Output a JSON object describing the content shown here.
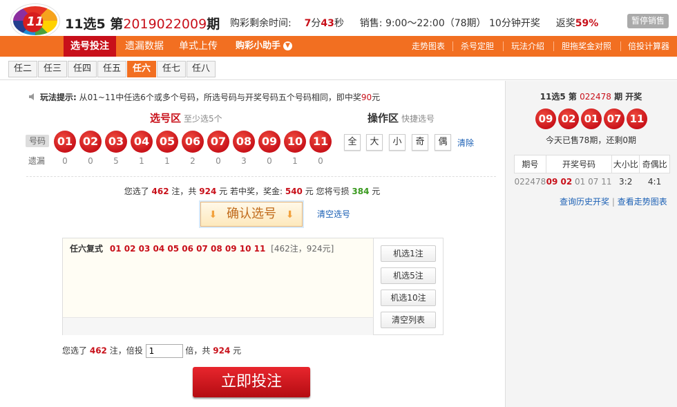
{
  "header": {
    "logo_text": "11",
    "lottery_name": "11选5",
    "issue_prefix": "第",
    "issue_number": "2019022009",
    "issue_suffix": "期",
    "countdown_label": "购彩剩余时间:",
    "countdown_min": "7",
    "min_unit": "分",
    "countdown_sec": "43",
    "sec_unit": "秒",
    "sales_label": "销售:",
    "sales_time": "9:00～22:00（78期）",
    "draw_freq": "10分钟开奖",
    "rebate_label": "返奖",
    "rebate_value": "59%",
    "stop_sales": "暂停销售"
  },
  "nav": {
    "items": [
      "选号投注",
      "遗漏数据",
      "单式上传",
      "购彩小助手"
    ],
    "right_links": [
      "走势图表",
      "杀号定胆",
      "玩法介绍",
      "胆拖奖金对照",
      "倍投计算器"
    ]
  },
  "subtabs": [
    "任二",
    "任三",
    "任四",
    "任五",
    "任六",
    "任七",
    "任八"
  ],
  "tip": {
    "label": "玩法提示:",
    "text": "从01~11中任选6个或多个号码，所选号码与开奖号码五个号码相同，即中奖",
    "prize": "90",
    "unit": "元"
  },
  "select_zone": {
    "title": "选号区",
    "subtitle": "至少选5个",
    "number_label": "号码",
    "miss_label": "遗漏",
    "numbers": [
      "01",
      "02",
      "03",
      "04",
      "05",
      "06",
      "07",
      "08",
      "09",
      "10",
      "11"
    ],
    "misses": [
      "0",
      "0",
      "5",
      "1",
      "1",
      "2",
      "0",
      "3",
      "0",
      "1",
      "0"
    ]
  },
  "op_zone": {
    "title": "操作区",
    "subtitle": "快捷选号",
    "buttons": [
      "全",
      "大",
      "小",
      "奇",
      "偶"
    ],
    "clear": "清除"
  },
  "summary": {
    "p1": "您选了",
    "bets": "462",
    "p2": "注，共",
    "amount": "924",
    "p3": "元 若中奖，奖金:",
    "prize": "540",
    "p4": "元 您将亏损",
    "loss": "384",
    "p5": "元"
  },
  "confirm": {
    "label": "确认选号",
    "clear_label": "清空选号"
  },
  "bet_list": {
    "type": "任六复式",
    "numbers": "01 02 03 04 05 06 07 08 09 10 11",
    "detail": "[462注，924元]",
    "buttons": [
      "机选1注",
      "机选5注",
      "机选10注",
      "清空列表"
    ]
  },
  "multiplier": {
    "p1": "您选了",
    "bets": "462",
    "p2": "注，倍投",
    "value": "1",
    "p3": "倍，共",
    "amount": "924",
    "p4": "元"
  },
  "bet_now": "立即投注",
  "right_panel": {
    "head_name": "11选5 第",
    "head_issue": "022478",
    "head_suffix": "期 开奖",
    "balls": [
      "09",
      "02",
      "01",
      "07",
      "11"
    ],
    "sold_text": "今天已售78期，还剩0期",
    "table_headers": [
      "期号",
      "开奖号码",
      "大小比",
      "奇偶比"
    ],
    "row": {
      "issue": "022478",
      "red_nums": "09 02",
      "nums_rest": "01 07 11",
      "size_ratio": "3:2",
      "odd_ratio": "4:1"
    },
    "link_history": "查询历史开奖",
    "link_divider": "|",
    "link_trend": "查看走势图表"
  }
}
